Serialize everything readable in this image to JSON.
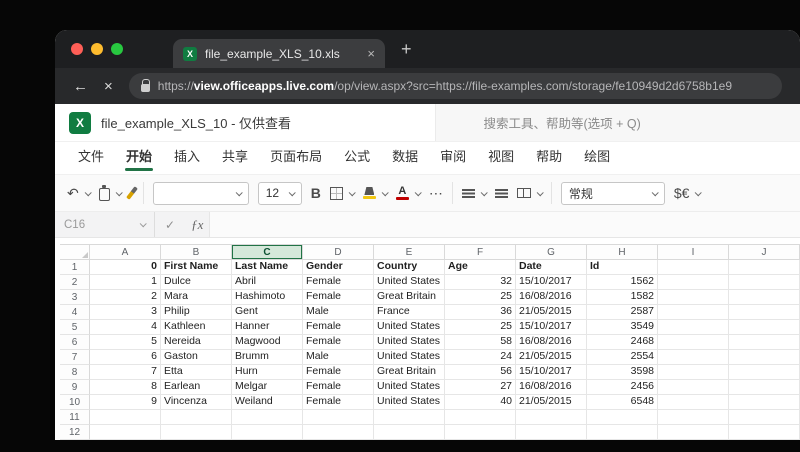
{
  "browser": {
    "tab_title": "file_example_XLS_10.xls",
    "url_scheme": "https://",
    "url_domain": "view.officeapps.live.com",
    "url_path": "/op/view.aspx?src=https://file-examples.com/storage/fe10949d2d6758b1e9",
    "icons": {
      "back": "←",
      "stop": "×",
      "new_tab": "+",
      "tab_close": "×",
      "excel_x": "X"
    }
  },
  "app": {
    "doc_title": "file_example_XLS_10 - 仅供查看",
    "search_placeholder": "搜索工具、帮助等(选项 + Q)",
    "menu": [
      "文件",
      "开始",
      "插入",
      "共享",
      "页面布局",
      "公式",
      "数据",
      "审阅",
      "视图",
      "帮助",
      "绘图"
    ],
    "active_menu_index": 1,
    "toolbar": {
      "undo_icon": "↶",
      "font_name": "",
      "font_size": "12",
      "bold_label": "B",
      "font_color_letter": "A",
      "more_icon": "⋯",
      "number_format": "常规",
      "currency_label": "$€",
      "accent_green": "#217346",
      "font_color_red": "#c00000",
      "fill_yellow": "#f2c811"
    },
    "formula_bar": {
      "name_box": "C16",
      "check_icon": "✓",
      "fx_icon": "ƒx"
    }
  },
  "sheet": {
    "columns": [
      "A",
      "B",
      "C",
      "D",
      "E",
      "F",
      "G",
      "H",
      "I",
      "J"
    ],
    "selected_column": "C",
    "visible_row_count": 13,
    "headers": [
      "0",
      "First Name",
      "Last Name",
      "Gender",
      "Country",
      "Age",
      "Date",
      "Id"
    ],
    "data_rows": [
      [
        "1",
        "Dulce",
        "Abril",
        "Female",
        "United States",
        "32",
        "15/10/2017",
        "1562"
      ],
      [
        "2",
        "Mara",
        "Hashimoto",
        "Female",
        "Great Britain",
        "25",
        "16/08/2016",
        "1582"
      ],
      [
        "3",
        "Philip",
        "Gent",
        "Male",
        "France",
        "36",
        "21/05/2015",
        "2587"
      ],
      [
        "4",
        "Kathleen",
        "Hanner",
        "Female",
        "United States",
        "25",
        "15/10/2017",
        "3549"
      ],
      [
        "5",
        "Nereida",
        "Magwood",
        "Female",
        "United States",
        "58",
        "16/08/2016",
        "2468"
      ],
      [
        "6",
        "Gaston",
        "Brumm",
        "Male",
        "United States",
        "24",
        "21/05/2015",
        "2554"
      ],
      [
        "7",
        "Etta",
        "Hurn",
        "Female",
        "Great Britain",
        "56",
        "15/10/2017",
        "3598"
      ],
      [
        "8",
        "Earlean",
        "Melgar",
        "Female",
        "United States",
        "27",
        "16/08/2016",
        "2456"
      ],
      [
        "9",
        "Vincenza",
        "Weiland",
        "Female",
        "United States",
        "40",
        "21/05/2015",
        "6548"
      ]
    ]
  }
}
